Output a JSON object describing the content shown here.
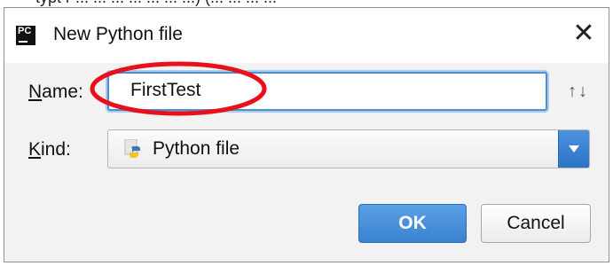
{
  "background_snippet": "typt r ... ... ... ... ... ... ...) (... ... ... ...",
  "dialog": {
    "title": "New Python file",
    "app_icon_text": "PC",
    "close_glyph": "✕"
  },
  "form": {
    "name_label_underlined": "N",
    "name_label_rest": "ame:",
    "name_value": "FirstTest",
    "kind_label_underlined": "K",
    "kind_label_rest": "ind:",
    "kind_value": "Python file",
    "sort_glyph": "↑↓"
  },
  "buttons": {
    "ok_label": "OK",
    "cancel_label": "Cancel"
  },
  "annotation": {
    "highlight_color": "#e8101a"
  },
  "colors": {
    "accent": "#3a82cf",
    "focus_border": "#4d8fd4"
  }
}
